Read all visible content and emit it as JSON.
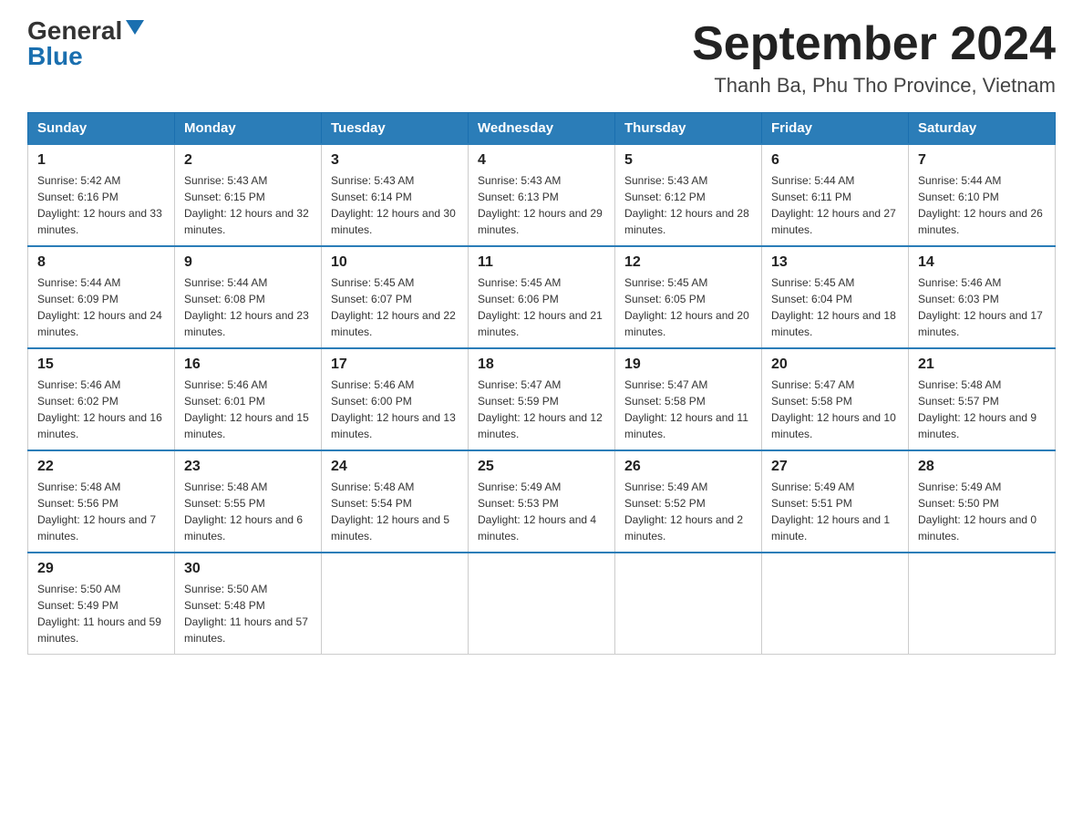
{
  "header": {
    "logo_general": "General",
    "logo_blue": "Blue",
    "month_title": "September 2024",
    "location": "Thanh Ba, Phu Tho Province, Vietnam"
  },
  "days_of_week": [
    "Sunday",
    "Monday",
    "Tuesday",
    "Wednesday",
    "Thursday",
    "Friday",
    "Saturday"
  ],
  "weeks": [
    [
      {
        "day": "1",
        "sunrise": "5:42 AM",
        "sunset": "6:16 PM",
        "daylight": "12 hours and 33 minutes."
      },
      {
        "day": "2",
        "sunrise": "5:43 AM",
        "sunset": "6:15 PM",
        "daylight": "12 hours and 32 minutes."
      },
      {
        "day": "3",
        "sunrise": "5:43 AM",
        "sunset": "6:14 PM",
        "daylight": "12 hours and 30 minutes."
      },
      {
        "day": "4",
        "sunrise": "5:43 AM",
        "sunset": "6:13 PM",
        "daylight": "12 hours and 29 minutes."
      },
      {
        "day": "5",
        "sunrise": "5:43 AM",
        "sunset": "6:12 PM",
        "daylight": "12 hours and 28 minutes."
      },
      {
        "day": "6",
        "sunrise": "5:44 AM",
        "sunset": "6:11 PM",
        "daylight": "12 hours and 27 minutes."
      },
      {
        "day": "7",
        "sunrise": "5:44 AM",
        "sunset": "6:10 PM",
        "daylight": "12 hours and 26 minutes."
      }
    ],
    [
      {
        "day": "8",
        "sunrise": "5:44 AM",
        "sunset": "6:09 PM",
        "daylight": "12 hours and 24 minutes."
      },
      {
        "day": "9",
        "sunrise": "5:44 AM",
        "sunset": "6:08 PM",
        "daylight": "12 hours and 23 minutes."
      },
      {
        "day": "10",
        "sunrise": "5:45 AM",
        "sunset": "6:07 PM",
        "daylight": "12 hours and 22 minutes."
      },
      {
        "day": "11",
        "sunrise": "5:45 AM",
        "sunset": "6:06 PM",
        "daylight": "12 hours and 21 minutes."
      },
      {
        "day": "12",
        "sunrise": "5:45 AM",
        "sunset": "6:05 PM",
        "daylight": "12 hours and 20 minutes."
      },
      {
        "day": "13",
        "sunrise": "5:45 AM",
        "sunset": "6:04 PM",
        "daylight": "12 hours and 18 minutes."
      },
      {
        "day": "14",
        "sunrise": "5:46 AM",
        "sunset": "6:03 PM",
        "daylight": "12 hours and 17 minutes."
      }
    ],
    [
      {
        "day": "15",
        "sunrise": "5:46 AM",
        "sunset": "6:02 PM",
        "daylight": "12 hours and 16 minutes."
      },
      {
        "day": "16",
        "sunrise": "5:46 AM",
        "sunset": "6:01 PM",
        "daylight": "12 hours and 15 minutes."
      },
      {
        "day": "17",
        "sunrise": "5:46 AM",
        "sunset": "6:00 PM",
        "daylight": "12 hours and 13 minutes."
      },
      {
        "day": "18",
        "sunrise": "5:47 AM",
        "sunset": "5:59 PM",
        "daylight": "12 hours and 12 minutes."
      },
      {
        "day": "19",
        "sunrise": "5:47 AM",
        "sunset": "5:58 PM",
        "daylight": "12 hours and 11 minutes."
      },
      {
        "day": "20",
        "sunrise": "5:47 AM",
        "sunset": "5:58 PM",
        "daylight": "12 hours and 10 minutes."
      },
      {
        "day": "21",
        "sunrise": "5:48 AM",
        "sunset": "5:57 PM",
        "daylight": "12 hours and 9 minutes."
      }
    ],
    [
      {
        "day": "22",
        "sunrise": "5:48 AM",
        "sunset": "5:56 PM",
        "daylight": "12 hours and 7 minutes."
      },
      {
        "day": "23",
        "sunrise": "5:48 AM",
        "sunset": "5:55 PM",
        "daylight": "12 hours and 6 minutes."
      },
      {
        "day": "24",
        "sunrise": "5:48 AM",
        "sunset": "5:54 PM",
        "daylight": "12 hours and 5 minutes."
      },
      {
        "day": "25",
        "sunrise": "5:49 AM",
        "sunset": "5:53 PM",
        "daylight": "12 hours and 4 minutes."
      },
      {
        "day": "26",
        "sunrise": "5:49 AM",
        "sunset": "5:52 PM",
        "daylight": "12 hours and 2 minutes."
      },
      {
        "day": "27",
        "sunrise": "5:49 AM",
        "sunset": "5:51 PM",
        "daylight": "12 hours and 1 minute."
      },
      {
        "day": "28",
        "sunrise": "5:49 AM",
        "sunset": "5:50 PM",
        "daylight": "12 hours and 0 minutes."
      }
    ],
    [
      {
        "day": "29",
        "sunrise": "5:50 AM",
        "sunset": "5:49 PM",
        "daylight": "11 hours and 59 minutes."
      },
      {
        "day": "30",
        "sunrise": "5:50 AM",
        "sunset": "5:48 PM",
        "daylight": "11 hours and 57 minutes."
      },
      null,
      null,
      null,
      null,
      null
    ]
  ]
}
